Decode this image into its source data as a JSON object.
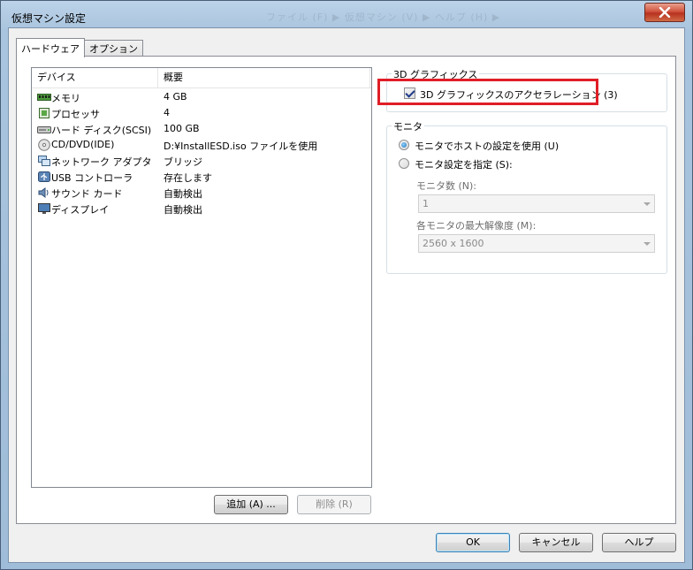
{
  "window": {
    "title": "仮想マシン設定",
    "title_ghost": "ファイル (F)  ▶  仮想マシン (V)  ▶  ヘルプ (H)  ▶"
  },
  "tabs": [
    {
      "label": "ハードウェア",
      "active": true
    },
    {
      "label": "オプション",
      "active": false
    }
  ],
  "device_list": {
    "headers": {
      "device": "デバイス",
      "summary": "概要"
    },
    "rows": [
      {
        "name": "メモリ",
        "summary": "4 GB",
        "icon": "memory-icon"
      },
      {
        "name": "プロセッサ",
        "summary": "4",
        "icon": "processor-icon"
      },
      {
        "name": "ハード ディスク(SCSI)",
        "summary": "100 GB",
        "icon": "hard-disk-icon"
      },
      {
        "name": "CD/DVD(IDE)",
        "summary": "D:¥InstallESD.iso ファイルを使用",
        "icon": "cd-dvd-icon"
      },
      {
        "name": "ネットワーク アダプタ",
        "summary": "ブリッジ",
        "icon": "network-adapter-icon"
      },
      {
        "name": "USB コントローラ",
        "summary": "存在します",
        "icon": "usb-icon"
      },
      {
        "name": "サウンド カード",
        "summary": "自動検出",
        "icon": "sound-card-icon"
      },
      {
        "name": "ディスプレイ",
        "summary": "自動検出",
        "icon": "display-icon"
      }
    ],
    "add_button": "追加 (A) ...",
    "remove_button": "削除 (R)"
  },
  "graphics": {
    "group_label": "3D グラフィックス",
    "accel_label": "3D グラフィックスのアクセラレーション (3)",
    "accel_checked": true
  },
  "monitor": {
    "group_label": "モニタ",
    "option_host": "モニタでホストの設定を使用 (U)",
    "option_specify": "モニタ設定を指定 (S):",
    "selected": "host",
    "count_label": "モニタ数 (N):",
    "count_value": "1",
    "max_res_label": "各モニタの最大解像度 (M):",
    "max_res_value": "2560 x 1600"
  },
  "footer": {
    "ok": "OK",
    "cancel": "キャンセル",
    "help": "ヘルプ"
  },
  "colors": {
    "highlight": "#e01e26",
    "close_button": "#c94a35"
  }
}
